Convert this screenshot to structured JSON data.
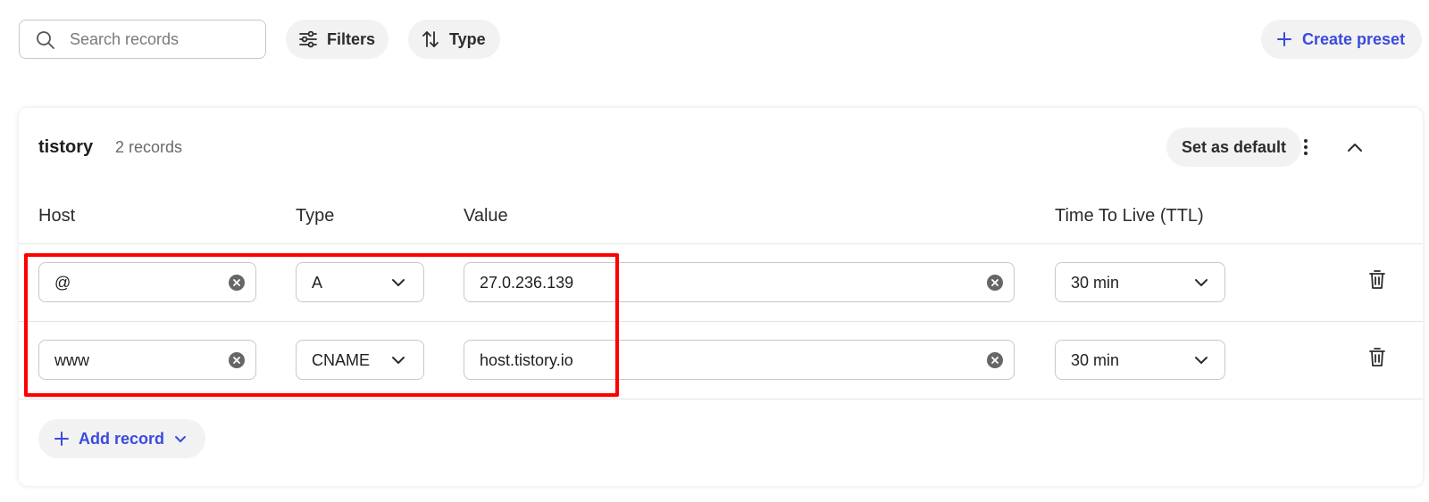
{
  "toolbar": {
    "search_placeholder": "Search records",
    "search_value": "",
    "filters_label": "Filters",
    "type_label": "Type",
    "create_preset_label": "Create preset"
  },
  "preset": {
    "name": "tistory",
    "count_label": "2 records",
    "set_default_label": "Set as default"
  },
  "columns": {
    "host": "Host",
    "type": "Type",
    "value": "Value",
    "ttl": "Time To Live (TTL)"
  },
  "records": [
    {
      "host": "@",
      "type": "A",
      "value": "27.0.236.139",
      "ttl": "30 min"
    },
    {
      "host": "www",
      "type": "CNAME",
      "value": "host.tistory.io",
      "ttl": "30 min"
    }
  ],
  "add_record_label": "Add record",
  "colors": {
    "accent": "#3a4bde",
    "highlight": "#ff0000",
    "pill_bg": "#f2f2f2"
  },
  "icons": [
    "search-icon",
    "sliders-icon",
    "sort-icon",
    "plus-icon",
    "more-vertical-icon",
    "chevron-up-icon",
    "clear-icon",
    "chevron-down-icon",
    "trash-icon"
  ]
}
